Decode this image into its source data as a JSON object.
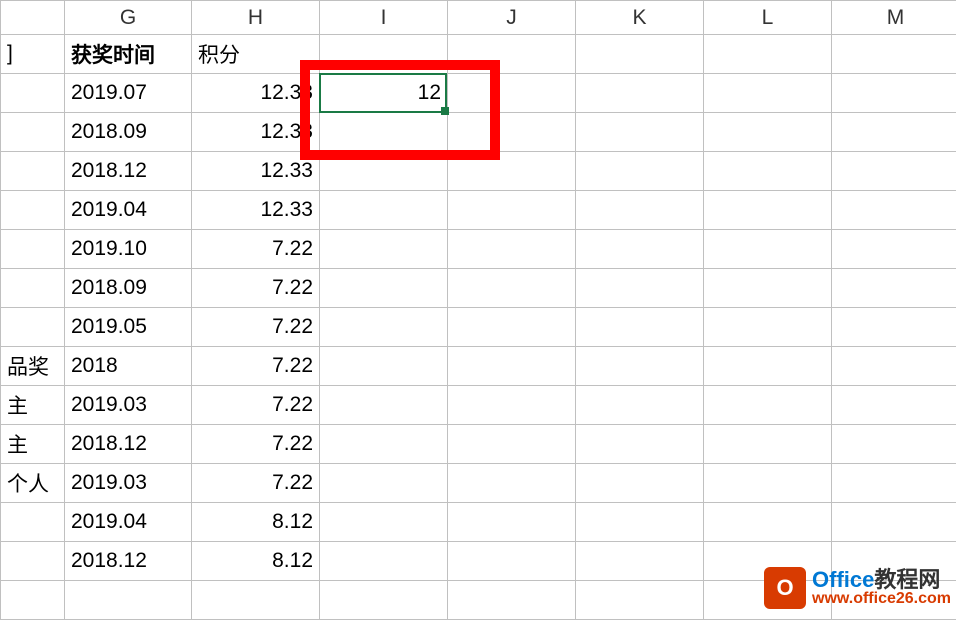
{
  "columns": {
    "g": "G",
    "h": "H",
    "i": "I",
    "j": "J",
    "k": "K",
    "l": "L",
    "m": "M"
  },
  "header_row": {
    "f_partial": "]",
    "g": "获奖时间",
    "h": "积分"
  },
  "rows": [
    {
      "f": "",
      "g": "2019.07",
      "h": "12.33",
      "i": "12"
    },
    {
      "f": "",
      "g": "2018.09",
      "h": "12.33",
      "i": ""
    },
    {
      "f": "",
      "g": "2018.12",
      "h": "12.33",
      "i": ""
    },
    {
      "f": "",
      "g": "2019.04",
      "h": "12.33",
      "i": ""
    },
    {
      "f": "",
      "g": "2019.10",
      "h": "7.22",
      "i": ""
    },
    {
      "f": "",
      "g": "2018.09",
      "h": "7.22",
      "i": ""
    },
    {
      "f": "",
      "g": "2019.05",
      "h": "7.22",
      "i": ""
    },
    {
      "f": "品奖",
      "g": "2018",
      "h": "7.22",
      "i": ""
    },
    {
      "f": "主",
      "g": "2019.03",
      "h": "7.22",
      "i": ""
    },
    {
      "f": "主",
      "g": "2018.12",
      "h": "7.22",
      "i": ""
    },
    {
      "f": "个人",
      "g": "2019.03",
      "h": "7.22",
      "i": ""
    },
    {
      "f": "",
      "g": "2019.04",
      "h": "8.12",
      "i": ""
    },
    {
      "f": "",
      "g": "2018.12",
      "h": "8.12",
      "i": ""
    }
  ],
  "selected_value": "12",
  "watermark": {
    "icon_letter": "O",
    "brand_blue": "Office",
    "brand_black": "教程网",
    "url": "www.office26.com"
  }
}
